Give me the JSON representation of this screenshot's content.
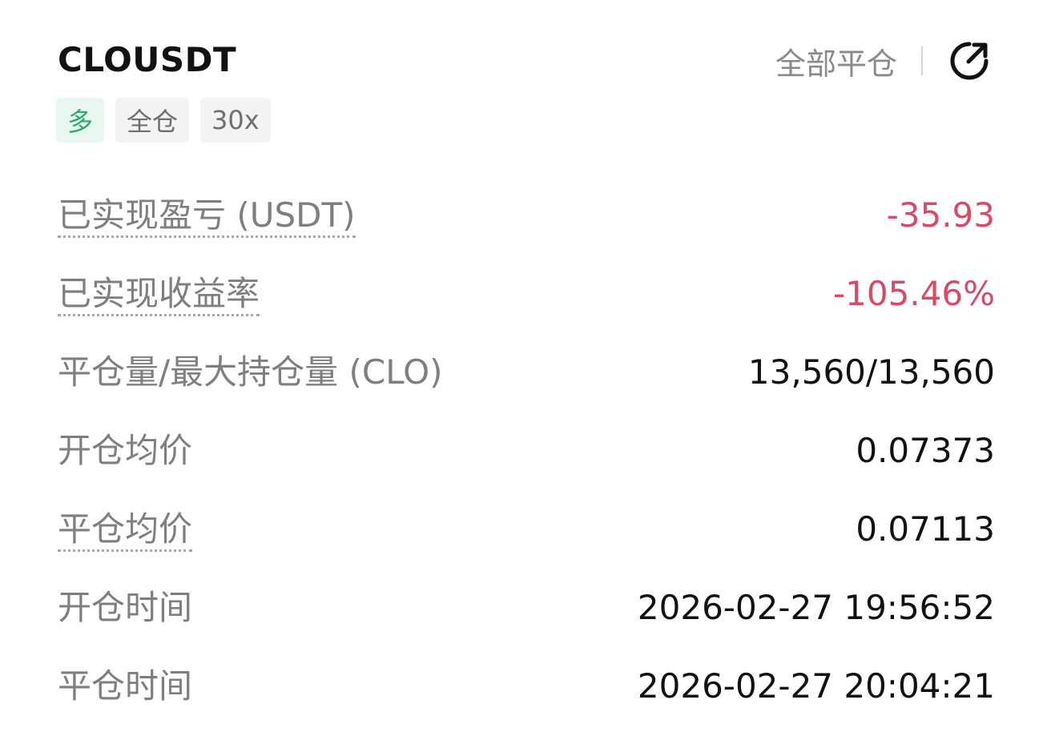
{
  "header": {
    "symbol": "CLOUSDT",
    "close_all_label": "全部平仓",
    "share_icon": "share-arrow-icon"
  },
  "tags": [
    {
      "label": "多",
      "kind": "long",
      "color": "#2eaa67"
    },
    {
      "label": "全仓",
      "kind": "margin-mode"
    },
    {
      "label": "30x",
      "kind": "leverage"
    }
  ],
  "rows": [
    {
      "label": "已实现盈亏 (USDT)",
      "value": "-35.93",
      "negative": true,
      "dotted": true
    },
    {
      "label": "已实现收益率",
      "value": "-105.46%",
      "negative": true,
      "dotted": true
    },
    {
      "label": "平仓量/最大持仓量 (CLO)",
      "value": "13,560/13,560",
      "negative": false,
      "dotted": false
    },
    {
      "label": "开仓均价",
      "value": "0.07373",
      "negative": false,
      "dotted": false
    },
    {
      "label": "平仓均价",
      "value": "0.07113",
      "negative": false,
      "dotted": true
    },
    {
      "label": "开仓时间",
      "value": "2026-02-27 19:56:52",
      "negative": false,
      "dotted": false
    },
    {
      "label": "平仓时间",
      "value": "2026-02-27 20:04:21",
      "negative": false,
      "dotted": false
    }
  ],
  "colors": {
    "negative": "#d94a67",
    "long_tag": "#2eaa67",
    "label_gray": "#7f7f7f"
  }
}
